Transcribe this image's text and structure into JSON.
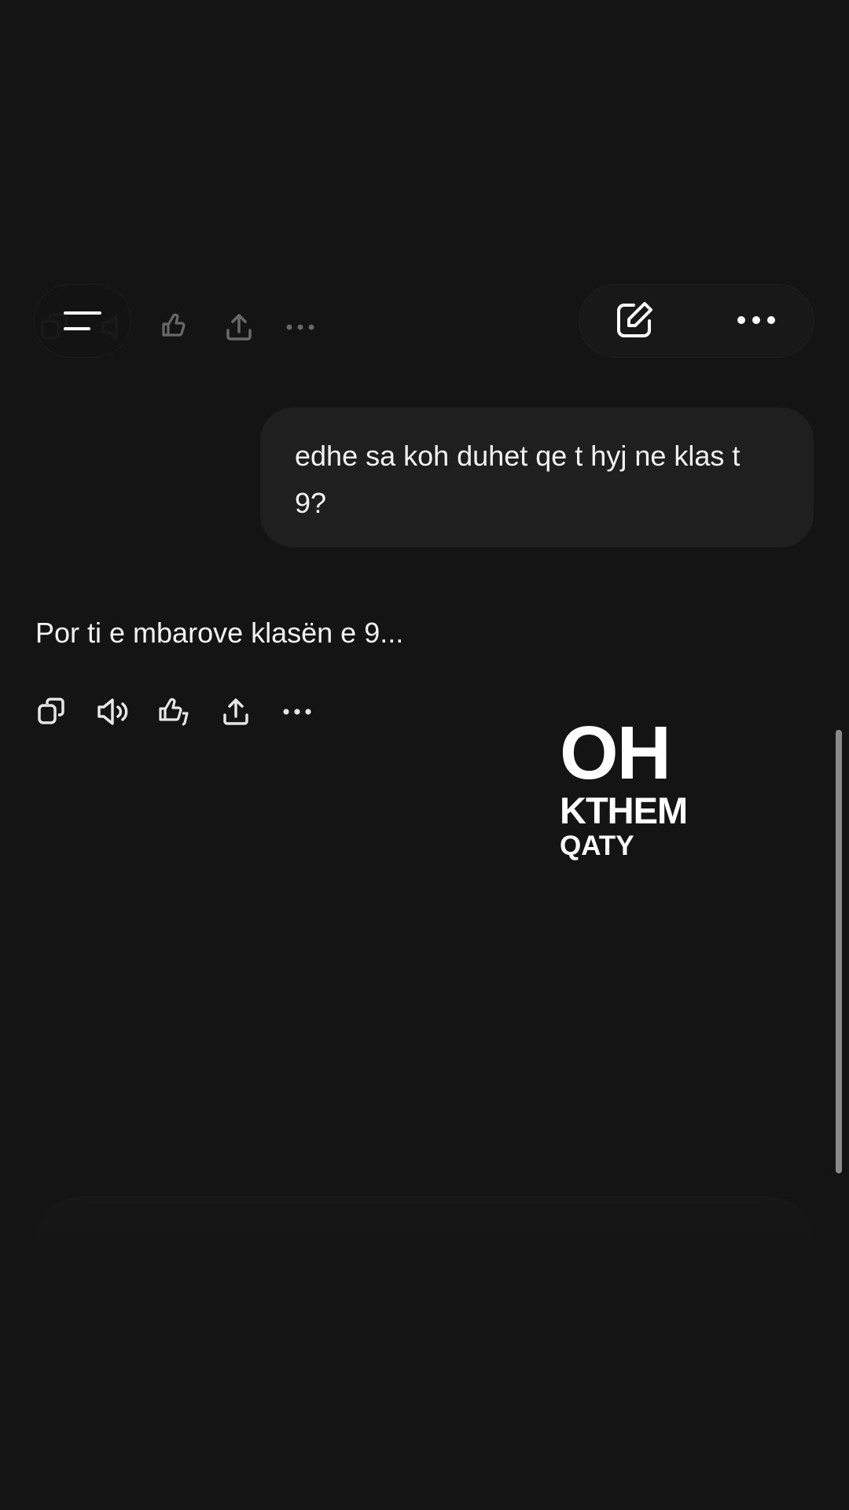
{
  "header": {
    "menu_icon": "menu-icon",
    "edit_icon": "edit-icon",
    "more_icon": "more-icon"
  },
  "conversation": {
    "user_message": "edhe sa koh duhet qe t hyj ne klas t 9?",
    "assistant_message": "Por ti e mbarove klasën e 9...",
    "action_icons": [
      "copy-icon",
      "speaker-icon",
      "thumbs-icon",
      "share-icon",
      "more-icon"
    ]
  },
  "overlay": {
    "line1": "OH",
    "line2": "KTHEM",
    "line3": "QATY"
  },
  "colors": {
    "background": "#141414",
    "bubble": "#1f1f1f",
    "text": "#f2f2f2"
  }
}
